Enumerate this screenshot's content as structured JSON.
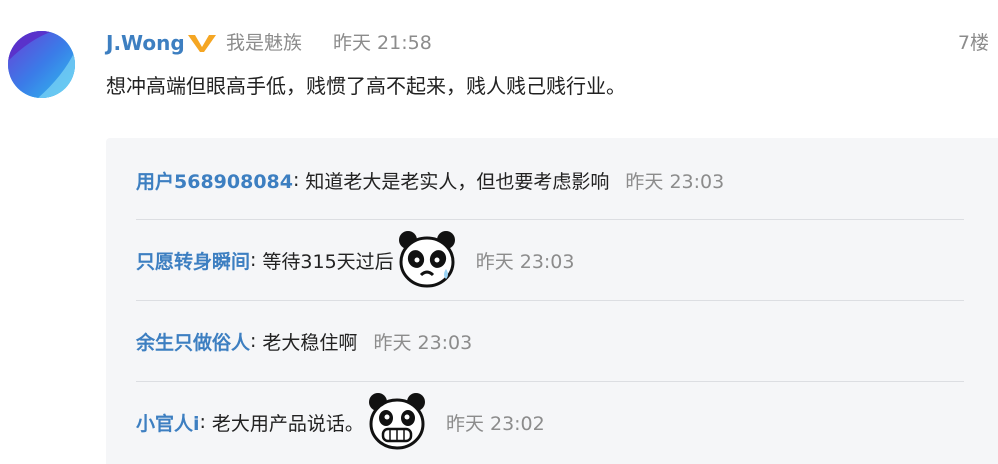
{
  "post": {
    "username": "J.Wong",
    "verified_icon": "verified-v-icon",
    "tagline": "我是魅族",
    "time": "昨天 21:58",
    "floor": "7楼",
    "content": "想冲高端但眼高手低，贱惯了高不起来，贱人贱己贱行业。"
  },
  "replies": [
    {
      "name": "用户568908084",
      "colon": ":",
      "text": "知道老大是老实人，但也要考虑影响",
      "time": "昨天 23:03",
      "emoji": ""
    },
    {
      "name": "只愿转身瞬间",
      "colon": ":",
      "text": "等待315天过后",
      "time": "昨天 23:03",
      "emoji": "panda-sweat-emoji-icon"
    },
    {
      "name": "余生只做俗人",
      "colon": ":",
      "text": "老大稳住啊",
      "time": "昨天 23:03",
      "emoji": ""
    },
    {
      "name": "小官人i",
      "colon": ":",
      "text": "老大用产品说话。",
      "time": "昨天 23:02",
      "emoji": "panda-grin-emoji-icon"
    }
  ],
  "colors": {
    "link": "#3d7fc1",
    "muted": "#8c8c8c",
    "badge": "#f5a623",
    "reply_bg": "#f5f6f8"
  }
}
